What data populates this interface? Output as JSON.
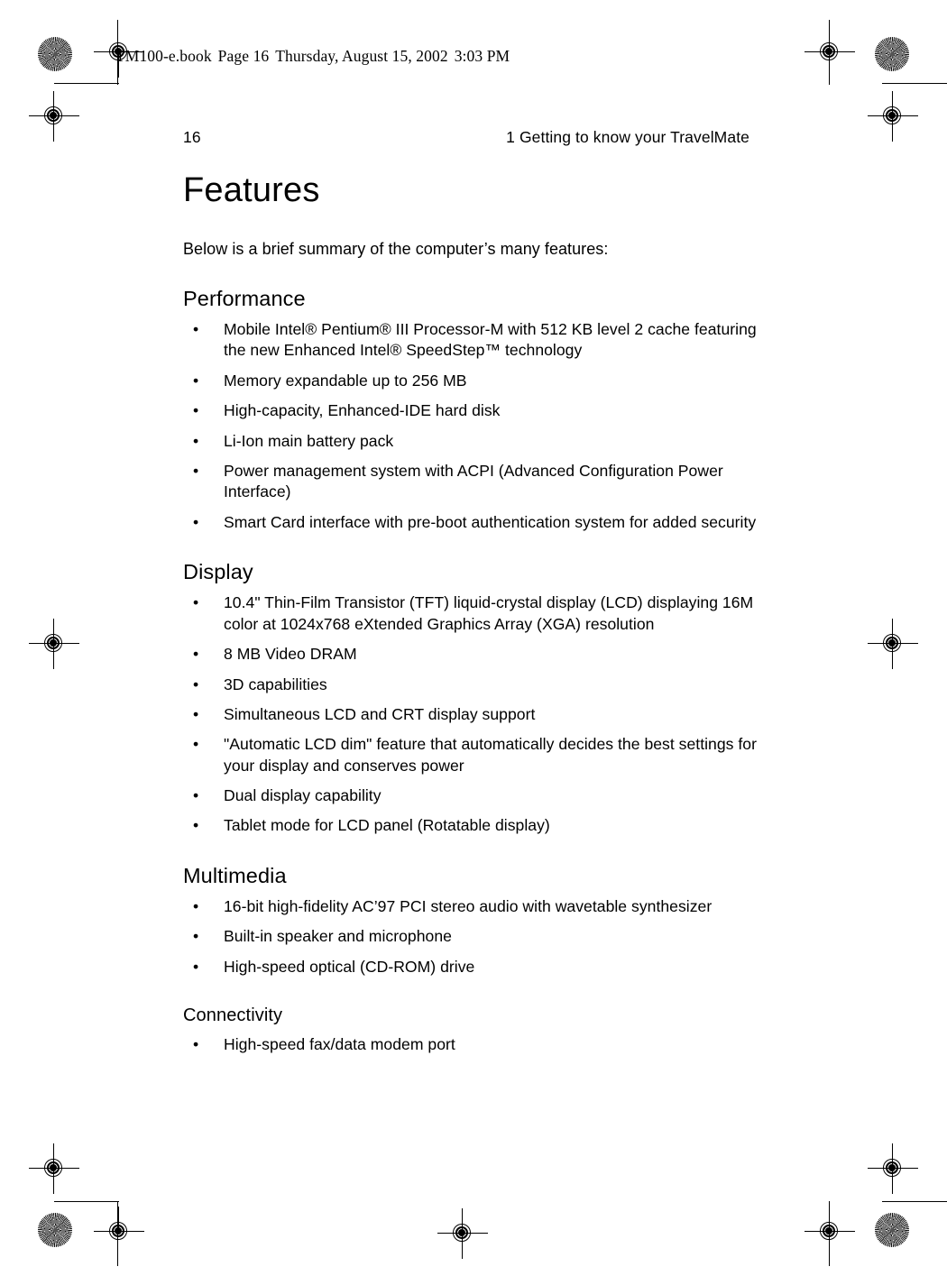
{
  "slug": {
    "file": "TM100-e.book",
    "page_label": "Page 16",
    "date": "Thursday, August 15, 2002",
    "time": "3:03 PM"
  },
  "header": {
    "page_number": "16",
    "chapter": "1 Getting to know your TravelMate"
  },
  "content": {
    "title": "Features",
    "intro": "Below is a brief summary of the computer’s many features:",
    "sections": [
      {
        "heading": "Performance",
        "style": "normal",
        "items": [
          "Mobile Intel® Pentium® III Processor-M with 512 KB level 2 cache featuring the new Enhanced Intel® SpeedStep™ technology",
          "Memory expandable up to 256 MB",
          "High-capacity, Enhanced-IDE hard disk",
          "Li-Ion main battery pack",
          "Power management system with ACPI (Advanced Configuration Power Interface)",
          "Smart Card interface with pre-boot authentication system for added security"
        ]
      },
      {
        "heading": "Display",
        "style": "normal",
        "items": [
          "10.4\" Thin-Film Transistor (TFT) liquid-crystal display (LCD) displaying 16M color at 1024x768 eXtended Graphics Array (XGA) resolution",
          "8 MB Video DRAM",
          "3D capabilities",
          "Simultaneous LCD and CRT display support",
          "\"Automatic LCD dim\" feature that automatically decides the best settings for your display and conserves power",
          "Dual display capability",
          "Tablet mode for LCD panel (Rotatable display)"
        ]
      },
      {
        "heading": "Multimedia",
        "style": "normal",
        "items": [
          "16-bit high-fidelity AC’97 PCI stereo audio with wavetable synthesizer",
          "Built-in speaker and microphone",
          "High-speed optical (CD-ROM) drive"
        ]
      },
      {
        "heading": "Connectivity",
        "style": "small",
        "items": [
          "High-speed fax/data modem port"
        ]
      }
    ],
    "bullet_glyph": "•"
  }
}
